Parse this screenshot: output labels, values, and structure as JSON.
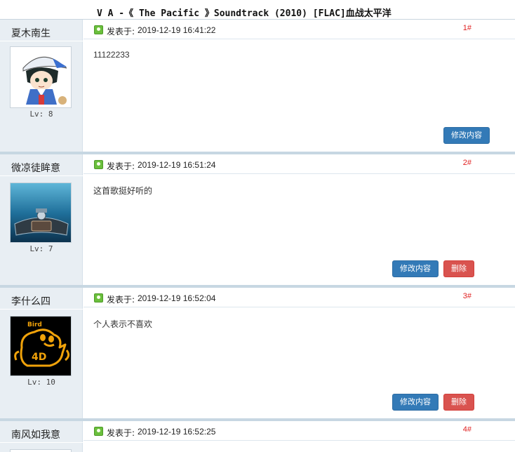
{
  "topic": {
    "title": "V A -《 The Pacific 》Soundtrack (2010) [FLAC]血战太平洋"
  },
  "labels": {
    "posted_at": "发表于:",
    "edit": "修改内容",
    "delete": "删除"
  },
  "posts": [
    {
      "author": "夏木南生",
      "level": "Lv: 8",
      "time": "2019-12-19 16:41:22",
      "floor": "1#",
      "content": "11122233",
      "avatar": "anime-boy-cap-avatar"
    },
    {
      "author": "微凉徒眸意",
      "level": "Lv: 7",
      "time": "2019-12-19 16:51:24",
      "floor": "2#",
      "content": "这首歌挺好听的",
      "avatar": "car-grille-avatar"
    },
    {
      "author": "李什么四",
      "level": "Lv: 10",
      "time": "2019-12-19 16:52:04",
      "floor": "3#",
      "content": "个人表示不喜欢",
      "avatar": "bird-4d-avatar"
    },
    {
      "author": "南风如我意",
      "level": "",
      "time": "2019-12-19 16:52:25",
      "floor": "4#",
      "content": "",
      "avatar": ""
    }
  ],
  "avatar_text": {
    "bird": "Bird",
    "badge": "4D"
  },
  "colors": {
    "edit": "#337ab7",
    "delete": "#d9534f",
    "floor": "#e02020",
    "sidebar": "#e8eef3",
    "separator": "#c7d7e2"
  }
}
